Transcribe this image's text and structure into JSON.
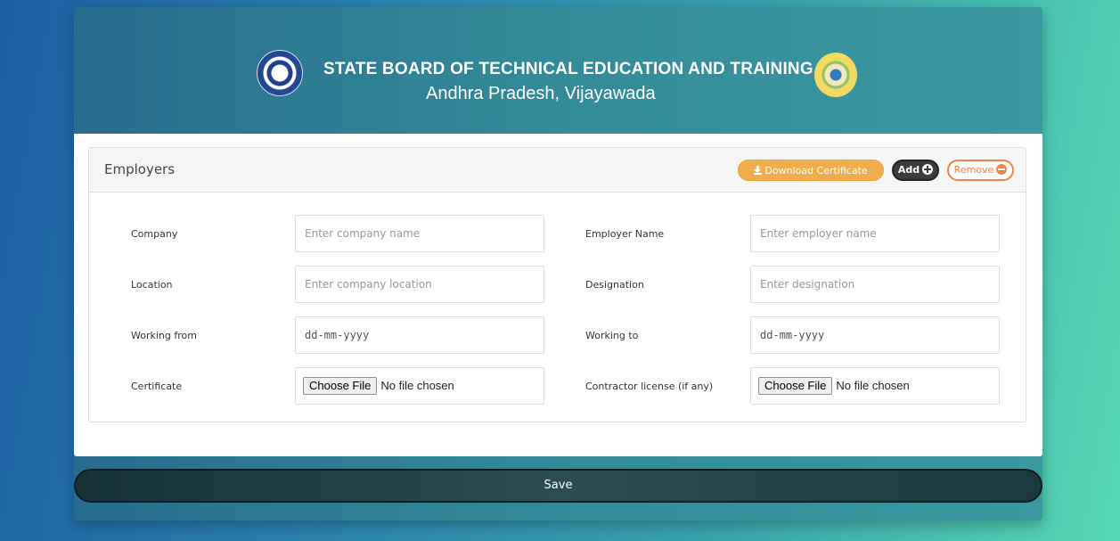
{
  "header": {
    "title": "STATE BOARD OF TECHNICAL EDUCATION AND TRAINING",
    "subtitle": "Andhra Pradesh, Vijayawada",
    "left_logo": "sbtet-emblem",
    "right_logo": "andhra-pradesh-emblem"
  },
  "panel": {
    "title": "Employers",
    "download_label": "Download Certificate",
    "add_label": "Add",
    "remove_label": "Remove"
  },
  "form": {
    "company": {
      "label": "Company",
      "placeholder": "Enter company name",
      "value": ""
    },
    "employer_name": {
      "label": "Employer Name",
      "placeholder": "Enter employer name",
      "value": ""
    },
    "location": {
      "label": "Location",
      "placeholder": "Enter company location",
      "value": ""
    },
    "designation": {
      "label": "Designation",
      "placeholder": "Enter designation",
      "value": ""
    },
    "working_from": {
      "label": "Working from",
      "value": "dd-mm-yyyy"
    },
    "working_to": {
      "label": "Working to",
      "value": "dd-mm-yyyy"
    },
    "certificate": {
      "label": "Certificate",
      "button": "Choose File",
      "status": "No file chosen"
    },
    "contractor_license": {
      "label": "Contractor license (if any)",
      "button": "Choose File",
      "status": "No file chosen"
    }
  },
  "save_label": "Save",
  "colors": {
    "download_button": "#f0ad4e",
    "remove_accent": "#f0834a",
    "add_button": "#3c3c3c",
    "save_button": "#1b3a40"
  }
}
